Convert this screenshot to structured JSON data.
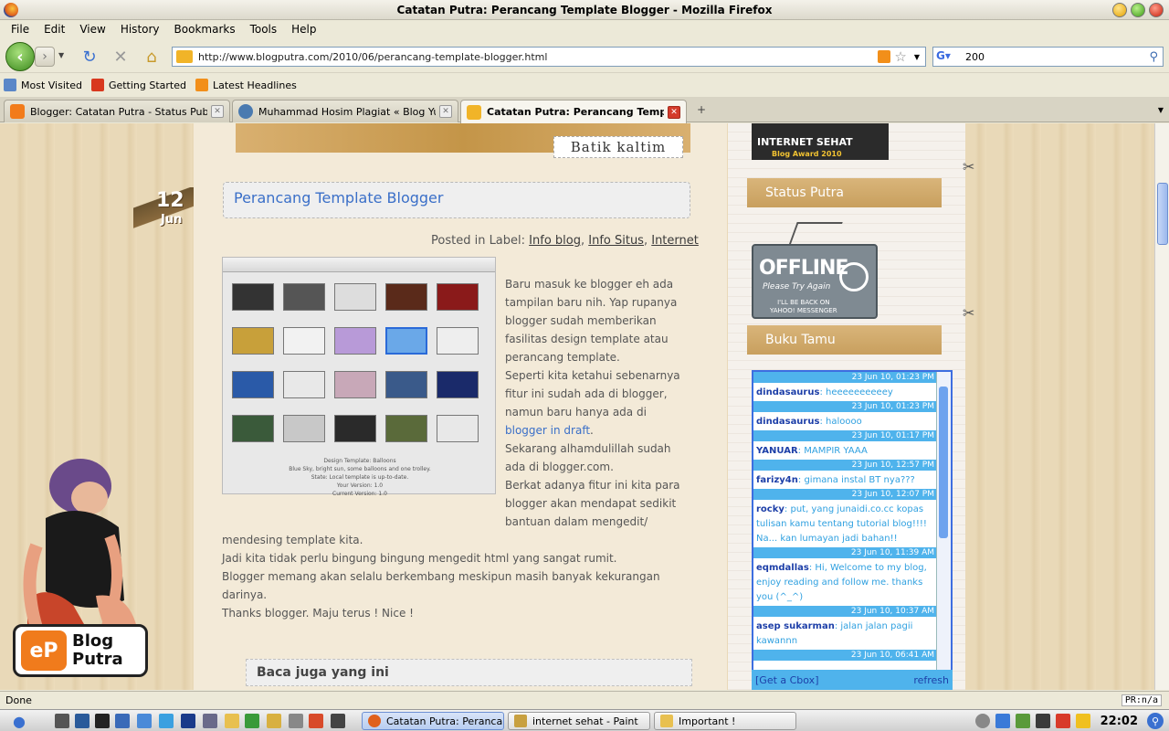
{
  "window": {
    "title": "Catatan Putra: Perancang Template Blogger - Mozilla Firefox"
  },
  "menu": [
    "File",
    "Edit",
    "View",
    "History",
    "Bookmarks",
    "Tools",
    "Help"
  ],
  "nav": {
    "url": "http://www.blogputra.com/2010/06/perancang-template-blogger.html",
    "search_value": "200",
    "search_engine_icon": "google-icon"
  },
  "bookmarks": [
    {
      "label": "Most Visited",
      "icon": "folder-icon",
      "color": "#5a87c8"
    },
    {
      "label": "Getting Started",
      "icon": "firefox-icon",
      "color": "#d8381e"
    },
    {
      "label": "Latest Headlines",
      "icon": "rss-icon",
      "color": "#f28f1a"
    }
  ],
  "tabs": [
    {
      "label": "Blogger: Catatan Putra - Status Publikasi",
      "icon": "blogger-icon",
      "color": "#f27b1a",
      "active": false
    },
    {
      "label": "Muhammad Hosim Plagiat « Blog Yudi ...",
      "icon": "wordpress-icon",
      "color": "#4a7ab0",
      "active": false
    },
    {
      "label": "Catatan Putra: Perancang Templ...",
      "icon": "site-icon",
      "color": "#f1b428",
      "active": true
    }
  ],
  "page": {
    "banner_label": "Batik kaltim",
    "date_day": "12",
    "date_month": "Jun",
    "post_title": "Perancang Template Blogger",
    "meta_prefix": "Posted in Label:",
    "labels": [
      "Info blog",
      "Info Situs",
      "Internet"
    ],
    "body": {
      "p1": "Baru masuk ke blogger eh ada tampilan baru nih. Yap rupanya blogger sudah memberikan fasilitas design template atau perancang template.",
      "p2a": "Seperti kita ketahui sebenarnya fitur ini sudah ada di blogger, namun baru hanya ada di ",
      "p2_link": "blogger in draft",
      "p2b": ".",
      "p3": "Sekarang alhamdulillah sudah ada di blogger.com.",
      "p4a": "Berkat adanya fitur ini kita para blogger akan mendapat sedikit bantuan dalam mengedit/",
      "p4b": "mendesing template kita.",
      "p5": "Jadi kita tidak perlu bingung bingung mengedit html yang sangat rumit.",
      "p6": "Blogger memang akan selalu berkembang meskipun masih banyak kekurangan darinya.",
      "p7": "Thanks blogger. Maju terus ! Nice !"
    },
    "image_caption": "Design Template: Balloons\nBlue Sky, bright sun, some balloons and one trolley.\nState: Local template is up-to-date.\nYour Version: 1.0\nCurrent Version: 1.0",
    "related_title": "Baca juga yang ini",
    "mascot_logo": {
      "badge": "eP",
      "line1": "Blog",
      "line2": "Putra"
    }
  },
  "sidebar": {
    "award_line1": "INTERNET SEHAT",
    "award_line2": "Blog Award 2010",
    "status_heading": "Status Putra",
    "offline_title": "OFFLINE",
    "offline_sub": "Please Try Again",
    "offline_note": "I'LL BE BACK ON\nYAHOO! MESSENGER",
    "guestbook_heading": "Buku Tamu",
    "cbox": [
      {
        "time": "23 Jun 10, 01:23 PM",
        "name": "dindasaurus",
        "text": "heeeeeeeeeey"
      },
      {
        "time": "23 Jun 10, 01:23 PM",
        "name": "dindasaurus",
        "text": "haloooo"
      },
      {
        "time": "23 Jun 10, 01:17 PM",
        "name": "YANUAR",
        "text": "MAMPIR YAAA"
      },
      {
        "time": "23 Jun 10, 12:57 PM",
        "name": "farizy4n",
        "text": "gimana instal BT nya???"
      },
      {
        "time": "23 Jun 10, 12:07 PM",
        "name": "rocky",
        "text": "put, yang junaidi.co.cc kopas tulisan kamu tentang tutorial blog!!!! Na... kan lumayan jadi bahan!!"
      },
      {
        "time": "23 Jun 10, 11:39 AM",
        "name": "eqmdallas",
        "text": "Hi, Welcome to my blog, enjoy reading and follow me. thanks you (^_^)"
      },
      {
        "time": "23 Jun 10, 10:37 AM",
        "name": "asep sukarman",
        "text": "jalan jalan pagii kawannn"
      },
      {
        "time": "23 Jun 10, 06:41 AM",
        "name": "",
        "text": ""
      }
    ],
    "cbox_get": "[Get a Cbox]",
    "cbox_refresh": "refresh"
  },
  "statusbar": {
    "text": "Done",
    "right": "PR:n/a"
  },
  "taskbar": {
    "tasks": [
      {
        "label": "Catatan Putra: Peranca...",
        "icon": "firefox-icon",
        "color": "#e0611c",
        "active": true
      },
      {
        "label": "internet sehat - Paint",
        "icon": "paint-icon",
        "color": "#c8a040",
        "active": false
      },
      {
        "label": "Important !",
        "icon": "folder-icon",
        "color": "#e8c050",
        "active": false
      }
    ],
    "clock": "22:02"
  }
}
